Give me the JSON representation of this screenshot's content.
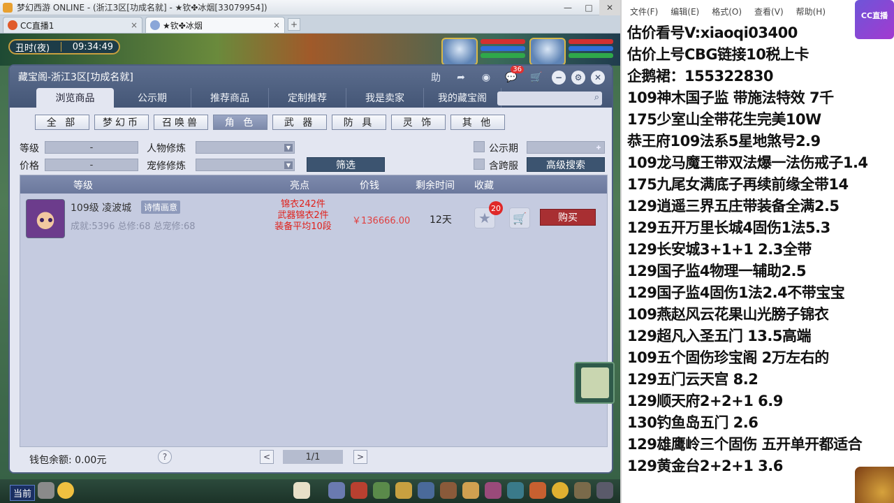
{
  "os_window": {
    "title": "梦幻西游 ONLINE - (浙江3区[功成名就] - ★钦✤冰烟[33079954])",
    "controls": [
      "—",
      "□",
      "✕"
    ]
  },
  "browser_tabs": [
    {
      "label": "CC直播1",
      "close": "×"
    },
    {
      "label": "★钦✤冰烟",
      "close": "×"
    }
  ],
  "new_tab": "+",
  "game_hud": {
    "time_of_day": "丑时(夜)",
    "clock": "09:34:49"
  },
  "cbg": {
    "title": "藏宝阁-浙江3区[功成名就]",
    "toolbar": {
      "help_label": "助",
      "share_icon": "share-icon",
      "record_icon": "record-icon",
      "message_badge": "36",
      "cart_icon": "cart-icon"
    },
    "window_buttons": [
      "−",
      "⚙",
      "✕"
    ],
    "nav_tabs": [
      "浏览商品",
      "公示期",
      "推荐商品",
      "定制推荐",
      "我是卖家",
      "我的藏宝阁"
    ],
    "search_placeholder": "",
    "categories": [
      "全 部",
      "梦幻币",
      "召唤兽",
      "角 色",
      "武 器",
      "防 具",
      "灵 饰",
      "其 他"
    ],
    "selected_category": "角 色",
    "filters": {
      "level_label": "等级",
      "level_value": "-",
      "price_label": "价格",
      "price_value": "-",
      "char_cultivation_label": "人物修炼",
      "pet_cultivation_label": "宠修修炼",
      "filter_button": "筛选",
      "public_label": "公示期",
      "cross_server_label": "含跨服",
      "advanced_search_button": "高级搜索"
    },
    "table_headers": {
      "level": "等级",
      "highlights": "亮点",
      "price": "价钱",
      "time_left": "剩余时间",
      "favorite": "收藏"
    },
    "listings": [
      {
        "name": "109级 凌波城",
        "tag": "诗情画意",
        "stats": "成就:5396 总修:68 总宠修:68",
        "highlights": [
          "锦衣242件",
          "武器锦衣2件",
          "装备平均10段"
        ],
        "price": "￥136666.00",
        "time_left": "12天",
        "favorite_count": "20",
        "buy_label": "购买"
      }
    ],
    "footer": {
      "wallet": "钱包余额: 0.00元",
      "help": "?",
      "prev": "<",
      "page": "1/1",
      "next": ">"
    }
  },
  "game_bottom": {
    "current_label": "当前"
  },
  "notepad": {
    "menu": [
      "文件(F)",
      "编辑(E)",
      "格式(O)",
      "查看(V)",
      "帮助(H)"
    ],
    "lines": [
      "估价看号V:xiaoqi03400",
      "估价上号CBG链接10税上卡",
      "企鹅裙：155322830",
      "109神木国子监 带施法特效 7千",
      "175少室山全带花生完美10W",
      "恭王府109法系5星地煞号2.9",
      "109龙马魔王带双法爆一法伤戒子1.4",
      "175九尾女满底子再续前缘全带14",
      "129逍遥三界五庄带装备全满2.5",
      "129五开万里长城4固伤1法5.3",
      "129长安城3+1+1 2.3全带",
      "129国子监4物理一辅助2.5",
      "129国子监4固伤1法2.4不带宝宝",
      "109燕赵风云花果山光膀子锦衣",
      "129超凡入圣五门 13.5高端",
      "109五个固伤珍宝阁 2万左右的",
      "129五门云天宫 8.2",
      "129顺天府2+2+1  6.9",
      "130钓鱼岛五门  2.6",
      "129雄鹰岭三个固伤 五开单开都适合",
      "129黄金台2+2+1 3.6"
    ],
    "badge_text": "CC直播"
  }
}
